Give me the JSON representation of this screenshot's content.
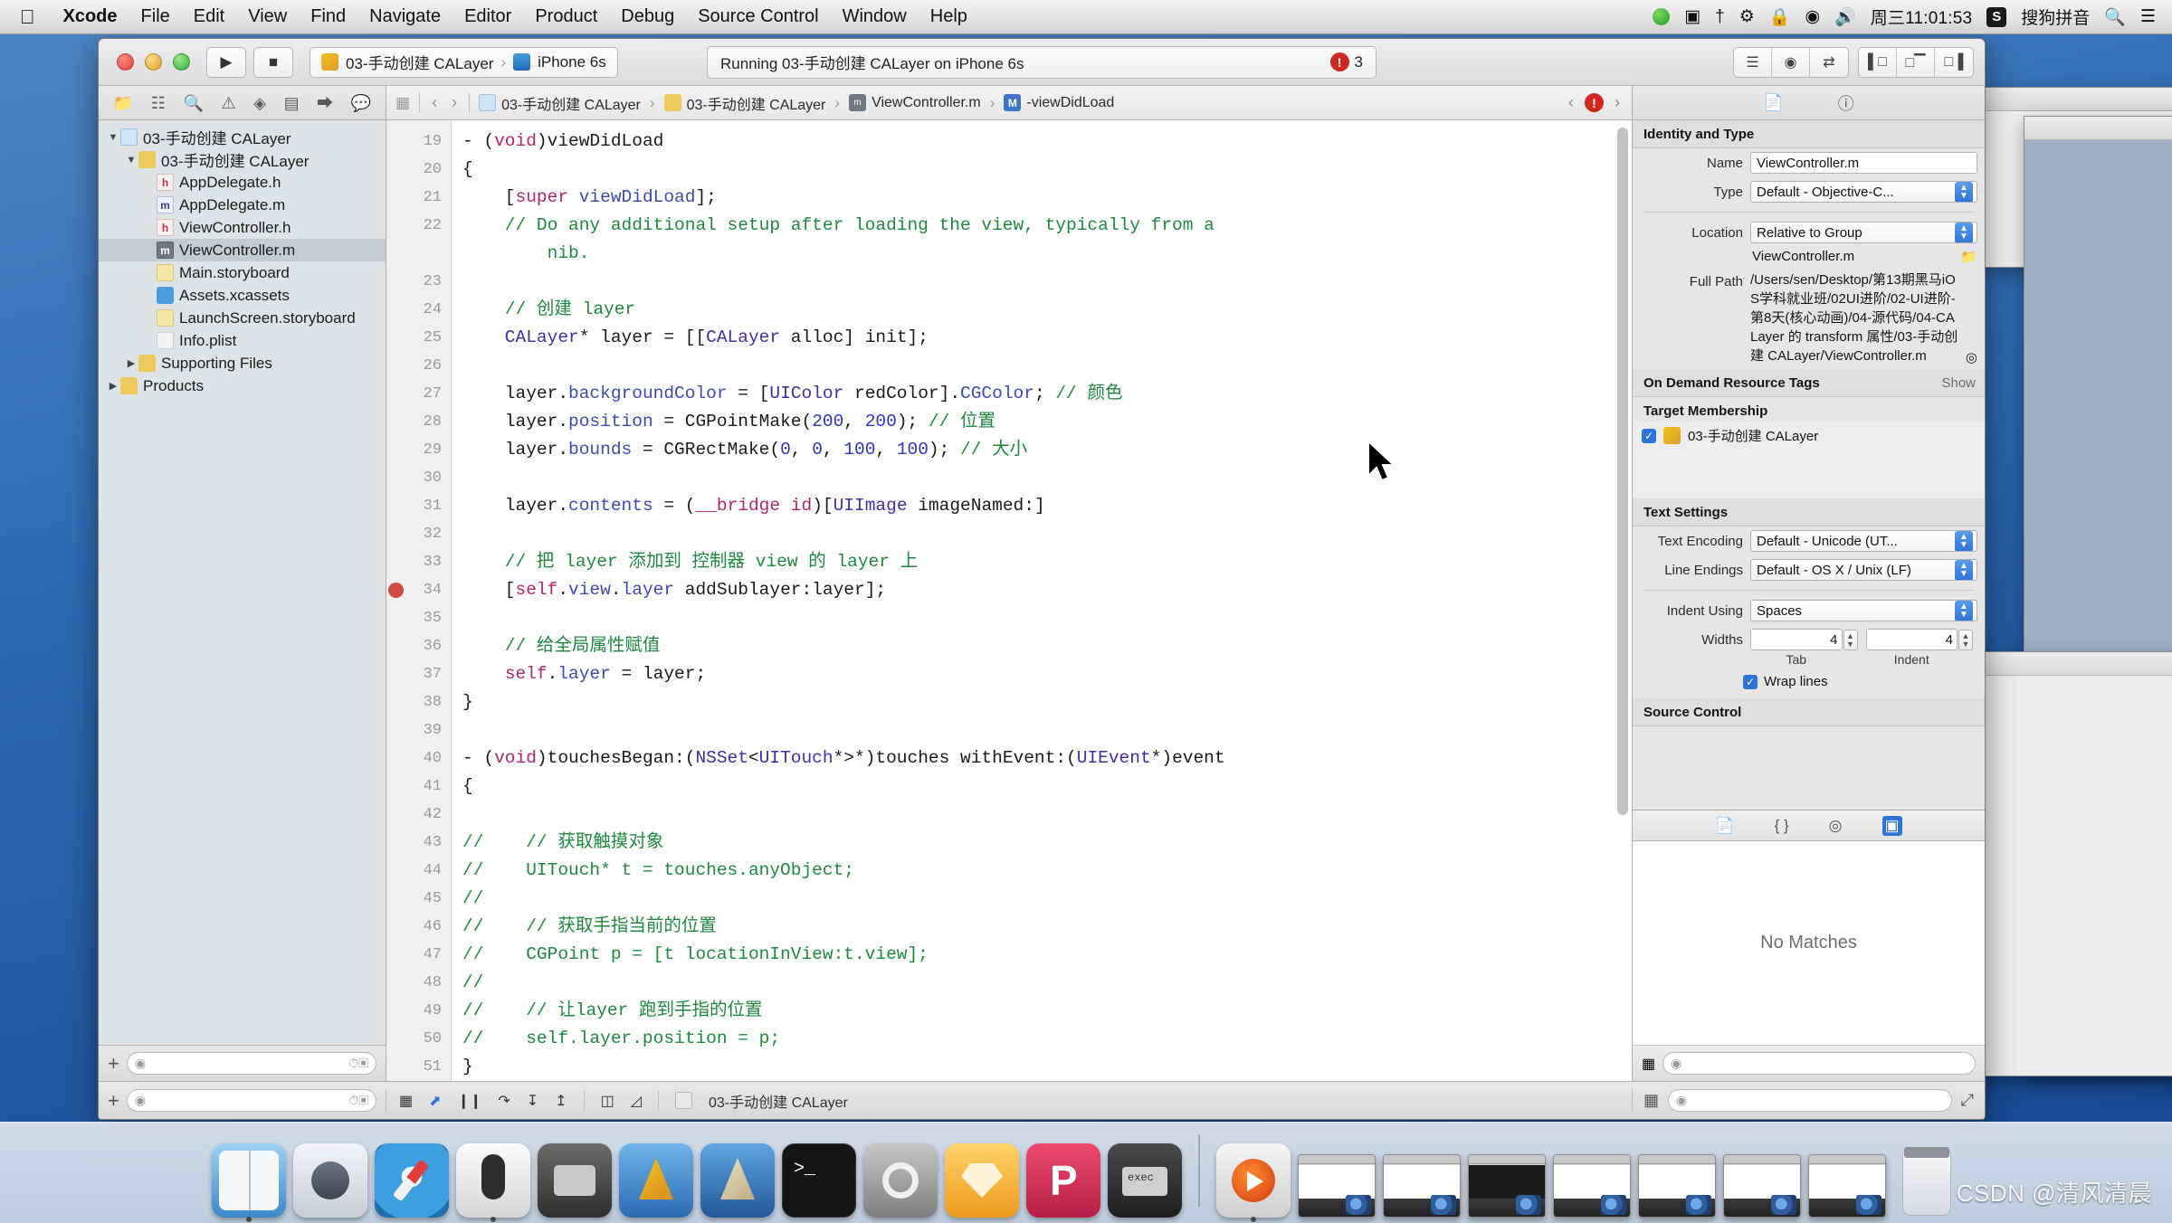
{
  "menubar": {
    "apple_icon": "apple-logo",
    "items": [
      {
        "label": "Xcode",
        "bold": true
      },
      {
        "label": "File",
        "bold": false
      },
      {
        "label": "Edit",
        "bold": false
      },
      {
        "label": "View",
        "bold": false
      },
      {
        "label": "Find",
        "bold": false
      },
      {
        "label": "Navigate",
        "bold": false
      },
      {
        "label": "Editor",
        "bold": false
      },
      {
        "label": "Product",
        "bold": false
      },
      {
        "label": "Debug",
        "bold": false
      },
      {
        "label": "Source Control",
        "bold": false
      },
      {
        "label": "Window",
        "bold": false
      },
      {
        "label": "Help",
        "bold": false
      }
    ],
    "status": {
      "clock": "周三11:01:53",
      "input_method": "搜狗拼音",
      "sogou_glyph": "S",
      "icons": [
        "screen-recording-icon",
        "airplay-icon",
        "bluetooth-icon",
        "lock-icon",
        "wifi-icon",
        "volume-icon",
        "spotlight-search-icon",
        "notification-center-icon"
      ]
    }
  },
  "toolbar": {
    "run_label": "▶",
    "stop_label": "■",
    "scheme_target": "03-手动创建 CALayer",
    "scheme_separator": "›",
    "scheme_device": "iPhone 6s",
    "activity": "Running 03-手动创建 CALayer on iPhone 6s",
    "error_count": "3",
    "view_buttons": [
      "standard-editor",
      "assistant-editor",
      "version-editor"
    ],
    "panel_buttons": [
      "toggle-navigator",
      "toggle-debug-area",
      "toggle-utilities"
    ]
  },
  "navigator": {
    "tabs": [
      "project-navigator",
      "symbol-navigator",
      "find-navigator",
      "issue-navigator",
      "test-navigator",
      "debug-navigator",
      "breakpoint-navigator",
      "report-navigator"
    ],
    "active_tab_index": 0,
    "tree": [
      {
        "label": "03-手动创建 CALayer",
        "indent": 0,
        "arrow": "▼",
        "icon": "project-icon",
        "selected": false
      },
      {
        "label": "03-手动创建 CALayer",
        "indent": 1,
        "arrow": "▼",
        "icon": "folder-yellow-icon",
        "selected": false
      },
      {
        "label": "AppDelegate.h",
        "indent": 2,
        "arrow": "",
        "icon": "header-file-icon",
        "selected": false
      },
      {
        "label": "AppDelegate.m",
        "indent": 2,
        "arrow": "",
        "icon": "objc-file-icon",
        "selected": false
      },
      {
        "label": "ViewController.h",
        "indent": 2,
        "arrow": "",
        "icon": "header-file-icon",
        "selected": false
      },
      {
        "label": "ViewController.m",
        "indent": 2,
        "arrow": "",
        "icon": "objc-file-selected-icon",
        "selected": true
      },
      {
        "label": "Main.storyboard",
        "indent": 2,
        "arrow": "",
        "icon": "storyboard-icon",
        "selected": false
      },
      {
        "label": "Assets.xcassets",
        "indent": 2,
        "arrow": "",
        "icon": "xcassets-icon",
        "selected": false
      },
      {
        "label": "LaunchScreen.storyboard",
        "indent": 2,
        "arrow": "",
        "icon": "storyboard-icon",
        "selected": false
      },
      {
        "label": "Info.plist",
        "indent": 2,
        "arrow": "",
        "icon": "plist-icon",
        "selected": false
      },
      {
        "label": "Supporting Files",
        "indent": 1,
        "arrow": "▶",
        "icon": "folder-yellow-icon",
        "selected": false
      },
      {
        "label": "Products",
        "indent": 0,
        "arrow": "▶",
        "icon": "folder-yellow-icon",
        "selected": false
      }
    ],
    "filter_placeholder": ""
  },
  "jumpbar": {
    "back_arrow": "‹",
    "forward_arrow": "›",
    "crumbs": [
      {
        "label": "03-手动创建 CALayer",
        "icon": "project-icon"
      },
      {
        "label": "03-手动创建 CALayer",
        "icon": "folder-yellow-icon"
      },
      {
        "label": "ViewController.m",
        "icon": "objc-file-icon"
      },
      {
        "label": "-viewDidLoad",
        "icon": "method-badge-icon"
      }
    ],
    "separator": "›",
    "issue_prev": "‹",
    "issue_next": "›",
    "issue_count_icon": "error-icon"
  },
  "editor": {
    "first_line_number": 19,
    "breakpoint_line": 34,
    "lines": [
      {
        "n": 19,
        "tokens": [
          [
            "pln",
            "- ("
          ],
          [
            "kw",
            "void"
          ],
          [
            "pln",
            ")viewDidLoad"
          ]
        ]
      },
      {
        "n": 20,
        "tokens": [
          [
            "pln",
            "{"
          ]
        ]
      },
      {
        "n": 21,
        "tokens": [
          [
            "pln",
            "    ["
          ],
          [
            "kw",
            "super"
          ],
          [
            "pln",
            " "
          ],
          [
            "prop",
            "viewDidLoad"
          ],
          [
            "pln",
            "];"
          ]
        ]
      },
      {
        "n": 22,
        "tokens": [
          [
            "cmt",
            "    // Do any additional setup after loading the view, typically from a"
          ]
        ]
      },
      {
        "n": "",
        "tokens": [
          [
            "cmt",
            "        nib."
          ]
        ]
      },
      {
        "n": 23,
        "tokens": [
          [
            "pln",
            ""
          ]
        ]
      },
      {
        "n": 24,
        "tokens": [
          [
            "cmt",
            "    // 创建 layer"
          ]
        ]
      },
      {
        "n": 25,
        "tokens": [
          [
            "cls",
            "    CALayer"
          ],
          [
            "pln",
            "* layer = [["
          ],
          [
            "cls",
            "CALayer"
          ],
          [
            "pln",
            " alloc] init];"
          ]
        ]
      },
      {
        "n": 26,
        "tokens": [
          [
            "pln",
            ""
          ]
        ]
      },
      {
        "n": 27,
        "tokens": [
          [
            "pln",
            "    layer."
          ],
          [
            "prop",
            "backgroundColor"
          ],
          [
            "pln",
            " = ["
          ],
          [
            "cls",
            "UIColor"
          ],
          [
            "pln",
            " redColor]."
          ],
          [
            "prop",
            "CGColor"
          ],
          [
            "pln",
            "; "
          ],
          [
            "cmt",
            "// 颜色"
          ]
        ]
      },
      {
        "n": 28,
        "tokens": [
          [
            "pln",
            "    layer."
          ],
          [
            "prop",
            "position"
          ],
          [
            "pln",
            " = CGPointMake("
          ],
          [
            "num",
            "200"
          ],
          [
            "pln",
            ", "
          ],
          [
            "num",
            "200"
          ],
          [
            "pln",
            "); "
          ],
          [
            "cmt",
            "// 位置"
          ]
        ]
      },
      {
        "n": 29,
        "tokens": [
          [
            "pln",
            "    layer."
          ],
          [
            "prop",
            "bounds"
          ],
          [
            "pln",
            " = CGRectMake("
          ],
          [
            "num",
            "0"
          ],
          [
            "pln",
            ", "
          ],
          [
            "num",
            "0"
          ],
          [
            "pln",
            ", "
          ],
          [
            "num",
            "100"
          ],
          [
            "pln",
            ", "
          ],
          [
            "num",
            "100"
          ],
          [
            "pln",
            "); "
          ],
          [
            "cmt",
            "// 大小"
          ]
        ]
      },
      {
        "n": 30,
        "tokens": [
          [
            "pln",
            ""
          ]
        ]
      },
      {
        "n": 31,
        "tokens": [
          [
            "pln",
            "    layer."
          ],
          [
            "prop",
            "contents"
          ],
          [
            "pln",
            " = ("
          ],
          [
            "kw",
            "__bridge"
          ],
          [
            "pln",
            " "
          ],
          [
            "kw",
            "id"
          ],
          [
            "pln",
            ")["
          ],
          [
            "cls",
            "UIImage"
          ],
          [
            "pln",
            " imageNamed:]"
          ]
        ]
      },
      {
        "n": 32,
        "tokens": [
          [
            "pln",
            ""
          ]
        ]
      },
      {
        "n": 33,
        "tokens": [
          [
            "cmt",
            "    // 把 layer 添加到 控制器 view 的 layer 上"
          ]
        ]
      },
      {
        "n": 34,
        "tokens": [
          [
            "pln",
            "    ["
          ],
          [
            "kw",
            "self"
          ],
          [
            "pln",
            "."
          ],
          [
            "prop",
            "view"
          ],
          [
            "pln",
            "."
          ],
          [
            "prop",
            "layer"
          ],
          [
            "pln",
            " addSublayer:layer];"
          ]
        ]
      },
      {
        "n": 35,
        "tokens": [
          [
            "pln",
            ""
          ]
        ]
      },
      {
        "n": 36,
        "tokens": [
          [
            "cmt",
            "    // 给全局属性赋值"
          ]
        ]
      },
      {
        "n": 37,
        "tokens": [
          [
            "pln",
            "    "
          ],
          [
            "kw",
            "self"
          ],
          [
            "pln",
            "."
          ],
          [
            "prop",
            "layer"
          ],
          [
            "pln",
            " = layer;"
          ]
        ]
      },
      {
        "n": 38,
        "tokens": [
          [
            "pln",
            "}"
          ]
        ]
      },
      {
        "n": 39,
        "tokens": [
          [
            "pln",
            ""
          ]
        ]
      },
      {
        "n": 40,
        "tokens": [
          [
            "pln",
            "- ("
          ],
          [
            "kw",
            "void"
          ],
          [
            "pln",
            ")touchesBegan:("
          ],
          [
            "cls",
            "NSSet"
          ],
          [
            "pln",
            "<"
          ],
          [
            "cls",
            "UITouch"
          ],
          [
            "pln",
            "*>*)touches withEvent:("
          ],
          [
            "cls",
            "UIEvent"
          ],
          [
            "pln",
            "*)event"
          ]
        ]
      },
      {
        "n": 41,
        "tokens": [
          [
            "pln",
            "{"
          ]
        ]
      },
      {
        "n": 42,
        "tokens": [
          [
            "pln",
            ""
          ]
        ]
      },
      {
        "n": 43,
        "tokens": [
          [
            "cmt",
            "//    // 获取触摸对象"
          ]
        ]
      },
      {
        "n": 44,
        "tokens": [
          [
            "cmt",
            "//    UITouch* t = touches.anyObject;"
          ]
        ]
      },
      {
        "n": 45,
        "tokens": [
          [
            "cmt",
            "//"
          ]
        ]
      },
      {
        "n": 46,
        "tokens": [
          [
            "cmt",
            "//    // 获取手指当前的位置"
          ]
        ]
      },
      {
        "n": 47,
        "tokens": [
          [
            "cmt",
            "//    CGPoint p = [t locationInView:t.view];"
          ]
        ]
      },
      {
        "n": 48,
        "tokens": [
          [
            "cmt",
            "//"
          ]
        ]
      },
      {
        "n": 49,
        "tokens": [
          [
            "cmt",
            "//    // 让layer 跑到手指的位置"
          ]
        ]
      },
      {
        "n": 50,
        "tokens": [
          [
            "cmt",
            "//    self.layer.position = p;"
          ]
        ]
      },
      {
        "n": 51,
        "tokens": [
          [
            "pln",
            "}"
          ]
        ]
      }
    ]
  },
  "inspector": {
    "tabs": [
      "file-inspector",
      "quick-help-inspector"
    ],
    "identity": {
      "section_title": "Identity and Type",
      "name_label": "Name",
      "name_value": "ViewController.m",
      "type_label": "Type",
      "type_value": "Default - Objective-C...",
      "location_label": "Location",
      "location_value": "Relative to Group",
      "location_file": "ViewController.m",
      "fullpath_label": "Full Path",
      "fullpath_value": "/Users/sen/Desktop/第13期黑马iOS学科就业班/02UI进阶/02-UI进阶-第8天(核心动画)/04-源代码/04-CALayer 的 transform 属性/03-手动创建 CALayer/ViewController.m"
    },
    "odr": {
      "section_title": "On Demand Resource Tags",
      "show_label": "Show"
    },
    "target_membership": {
      "section_title": "Target Membership",
      "items": [
        {
          "label": "03-手动创建 CALayer",
          "checked": true
        }
      ]
    },
    "text_settings": {
      "section_title": "Text Settings",
      "encoding_label": "Text Encoding",
      "encoding_value": "Default - Unicode (UT...",
      "line_endings_label": "Line Endings",
      "line_endings_value": "Default - OS X / Unix (LF)",
      "indent_label": "Indent Using",
      "indent_value": "Spaces",
      "widths_label": "Widths",
      "tab_width": "4",
      "indent_width": "4",
      "tab_caption": "Tab",
      "indent_caption": "Indent",
      "wrap_lines_label": "Wrap lines",
      "wrap_lines_checked": true
    },
    "source_control": {
      "section_title": "Source Control"
    },
    "library": {
      "tabs": [
        "file-template-library",
        "code-snippet-library",
        "object-library",
        "media-library"
      ],
      "active_tab_index": 3,
      "empty_message": "No Matches",
      "filter_placeholder": ""
    }
  },
  "bottom_bar": {
    "add_label": "+",
    "filter_placeholder": "",
    "debug_buttons": [
      "show-debug-area",
      "activate-breakpoints",
      "continue-pause",
      "step-over",
      "step-into",
      "step-out",
      "view-debugging",
      "location-simulate"
    ],
    "process_label": "03-手动创建 CALayer"
  },
  "dock": {
    "apps": [
      {
        "name": "finder-icon",
        "color": "#3aa0e8"
      },
      {
        "name": "launchpad-icon",
        "color": "#d9dde3"
      },
      {
        "name": "safari-icon",
        "color": "#2e9fe0"
      },
      {
        "name": "mouse-app-icon",
        "color": "#f3f3f3"
      },
      {
        "name": "quicktime-icon",
        "color": "#5b5b5b"
      },
      {
        "name": "xcode-icon",
        "color": "#4a8ed6"
      },
      {
        "name": "xcode-beta-icon",
        "color": "#3f7fc4"
      },
      {
        "name": "terminal-icon",
        "color": "#1c1c1c"
      },
      {
        "name": "system-preferences-icon",
        "color": "#8a8a8a"
      },
      {
        "name": "sketch-icon",
        "color": "#f0a92d"
      },
      {
        "name": "paw-icon",
        "color": "#d4335a"
      },
      {
        "name": "exec-icon",
        "color": "#2d2d2d"
      }
    ],
    "minimized_label": "minimized-windows",
    "trash_label": "trash-icon"
  },
  "watermark": "CSDN @清风清晨"
}
